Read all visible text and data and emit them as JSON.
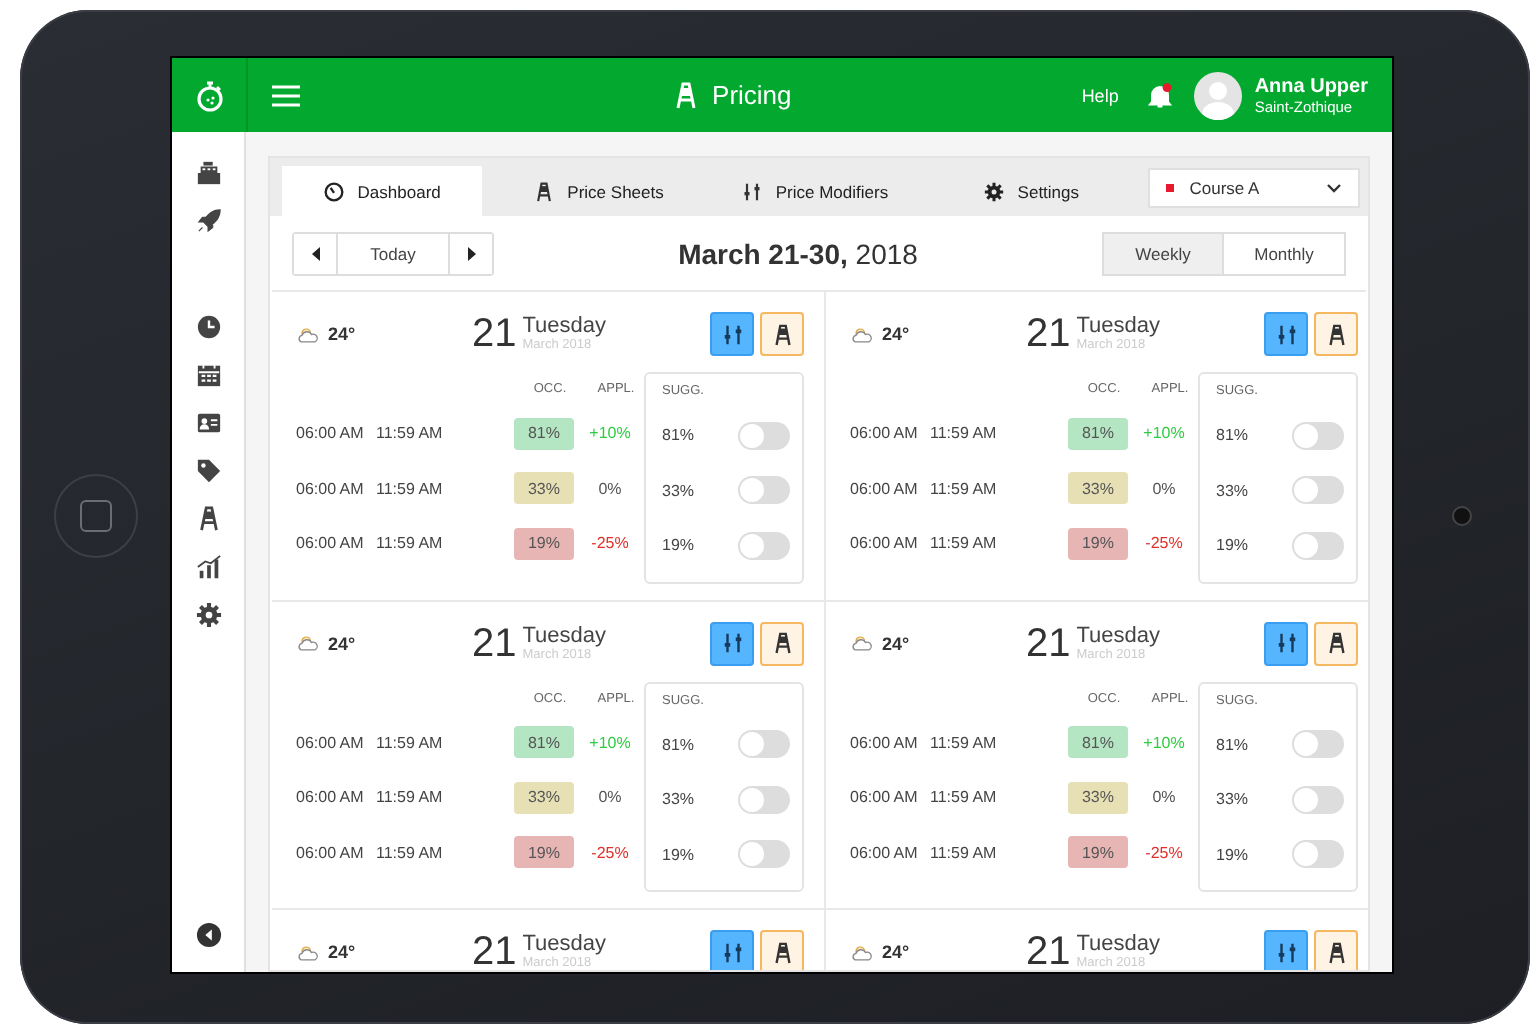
{
  "header": {
    "title": "Pricing",
    "help": "Help",
    "user": {
      "name": "Anna Upper",
      "location": "Saint-Zothique"
    }
  },
  "tabs": [
    {
      "label": "Dashboard",
      "kind": "dashboard",
      "selected": true
    },
    {
      "label": "Price Sheets",
      "kind": "sheets",
      "selected": false
    },
    {
      "label": "Price Modifiers",
      "kind": "modifiers",
      "selected": false
    },
    {
      "label": "Settings",
      "kind": "settings",
      "selected": false
    }
  ],
  "course_select": {
    "value": "Course A",
    "color": "#e8192c"
  },
  "date_nav": {
    "today": "Today",
    "range": "March 21-30,",
    "year": "2018"
  },
  "view_toggle": [
    {
      "label": "Weekly",
      "selected": true
    },
    {
      "label": "Monthly",
      "selected": false
    }
  ],
  "cards": [
    {
      "temperature": "24°",
      "day": "21",
      "weekday": "Tuesday",
      "month": "March 2018",
      "buttons": [
        {
          "kind": "modifiers",
          "selected": true
        },
        {
          "kind": "sheets",
          "selected": false
        }
      ],
      "columns": [
        "OCC.",
        "APPL.",
        "SUGG."
      ],
      "rows": [
        {
          "start": "06:00 AM",
          "end": "11:59 AM",
          "occupancy": {
            "value": "81%",
            "color": "#b5e6c3"
          },
          "applied": {
            "value": "+10%",
            "color": "#2ecc40"
          },
          "suggested": "81%",
          "on": false
        },
        {
          "start": "06:00 AM",
          "end": "11:59 AM",
          "occupancy": {
            "value": "33%",
            "color": "#e8e0b5"
          },
          "applied": {
            "value": "0%",
            "color": "#555555"
          },
          "suggested": "33%",
          "on": false
        },
        {
          "start": "06:00 AM",
          "end": "11:59 AM",
          "occupancy": {
            "value": "19%",
            "color": "#e8b5b5"
          },
          "applied": {
            "value": "-25%",
            "color": "#e0302a"
          },
          "suggested": "19%",
          "on": false
        }
      ]
    },
    {
      "temperature": "24°",
      "day": "21",
      "weekday": "Tuesday",
      "month": "March 2018",
      "buttons": [
        {
          "kind": "modifiers",
          "selected": true
        },
        {
          "kind": "sheets",
          "selected": false
        }
      ],
      "columns": [
        "OCC.",
        "APPL.",
        "SUGG."
      ],
      "rows": [
        {
          "start": "06:00 AM",
          "end": "11:59 AM",
          "occupancy": {
            "value": "81%",
            "color": "#b5e6c3"
          },
          "applied": {
            "value": "+10%",
            "color": "#2ecc40"
          },
          "suggested": "81%",
          "on": false
        },
        {
          "start": "06:00 AM",
          "end": "11:59 AM",
          "occupancy": {
            "value": "33%",
            "color": "#e8e0b5"
          },
          "applied": {
            "value": "0%",
            "color": "#555555"
          },
          "suggested": "33%",
          "on": false
        },
        {
          "start": "06:00 AM",
          "end": "11:59 AM",
          "occupancy": {
            "value": "19%",
            "color": "#e8b5b5"
          },
          "applied": {
            "value": "-25%",
            "color": "#e0302a"
          },
          "suggested": "19%",
          "on": false
        }
      ]
    },
    {
      "temperature": "24°",
      "day": "21",
      "weekday": "Tuesday",
      "month": "March 2018",
      "buttons": [
        {
          "kind": "modifiers",
          "selected": true
        },
        {
          "kind": "sheets",
          "selected": false
        }
      ],
      "columns": [
        "OCC.",
        "APPL.",
        "SUGG."
      ],
      "rows": [
        {
          "start": "06:00 AM",
          "end": "11:59 AM",
          "occupancy": {
            "value": "81%",
            "color": "#b5e6c3"
          },
          "applied": {
            "value": "+10%",
            "color": "#2ecc40"
          },
          "suggested": "81%",
          "on": false
        },
        {
          "start": "06:00 AM",
          "end": "11:59 AM",
          "occupancy": {
            "value": "33%",
            "color": "#e8e0b5"
          },
          "applied": {
            "value": "0%",
            "color": "#555555"
          },
          "suggested": "33%",
          "on": false
        },
        {
          "start": "06:00 AM",
          "end": "11:59 AM",
          "occupancy": {
            "value": "19%",
            "color": "#e8b5b5"
          },
          "applied": {
            "value": "-25%",
            "color": "#e0302a"
          },
          "suggested": "19%",
          "on": false
        }
      ]
    },
    {
      "temperature": "24°",
      "day": "21",
      "weekday": "Tuesday",
      "month": "March 2018",
      "buttons": [
        {
          "kind": "modifiers",
          "selected": true
        },
        {
          "kind": "sheets",
          "selected": false
        }
      ],
      "columns": [
        "OCC.",
        "APPL.",
        "SUGG."
      ],
      "rows": [
        {
          "start": "06:00 AM",
          "end": "11:59 AM",
          "occupancy": {
            "value": "81%",
            "color": "#b5e6c3"
          },
          "applied": {
            "value": "+10%",
            "color": "#2ecc40"
          },
          "suggested": "81%",
          "on": false
        },
        {
          "start": "06:00 AM",
          "end": "11:59 AM",
          "occupancy": {
            "value": "33%",
            "color": "#e8e0b5"
          },
          "applied": {
            "value": "0%",
            "color": "#555555"
          },
          "suggested": "33%",
          "on": false
        },
        {
          "start": "06:00 AM",
          "end": "11:59 AM",
          "occupancy": {
            "value": "19%",
            "color": "#e8b5b5"
          },
          "applied": {
            "value": "-25%",
            "color": "#e0302a"
          },
          "suggested": "19%",
          "on": false
        }
      ]
    },
    {
      "temperature": "24°",
      "day": "21",
      "weekday": "Tuesday",
      "month": "March 2018",
      "buttons": [
        {
          "kind": "modifiers",
          "selected": true
        },
        {
          "kind": "sheets",
          "selected": false
        }
      ]
    },
    {
      "temperature": "24°",
      "day": "21",
      "weekday": "Tuesday",
      "month": "March 2018",
      "buttons": [
        {
          "kind": "modifiers",
          "selected": true
        },
        {
          "kind": "sheets",
          "selected": false
        }
      ]
    }
  ]
}
